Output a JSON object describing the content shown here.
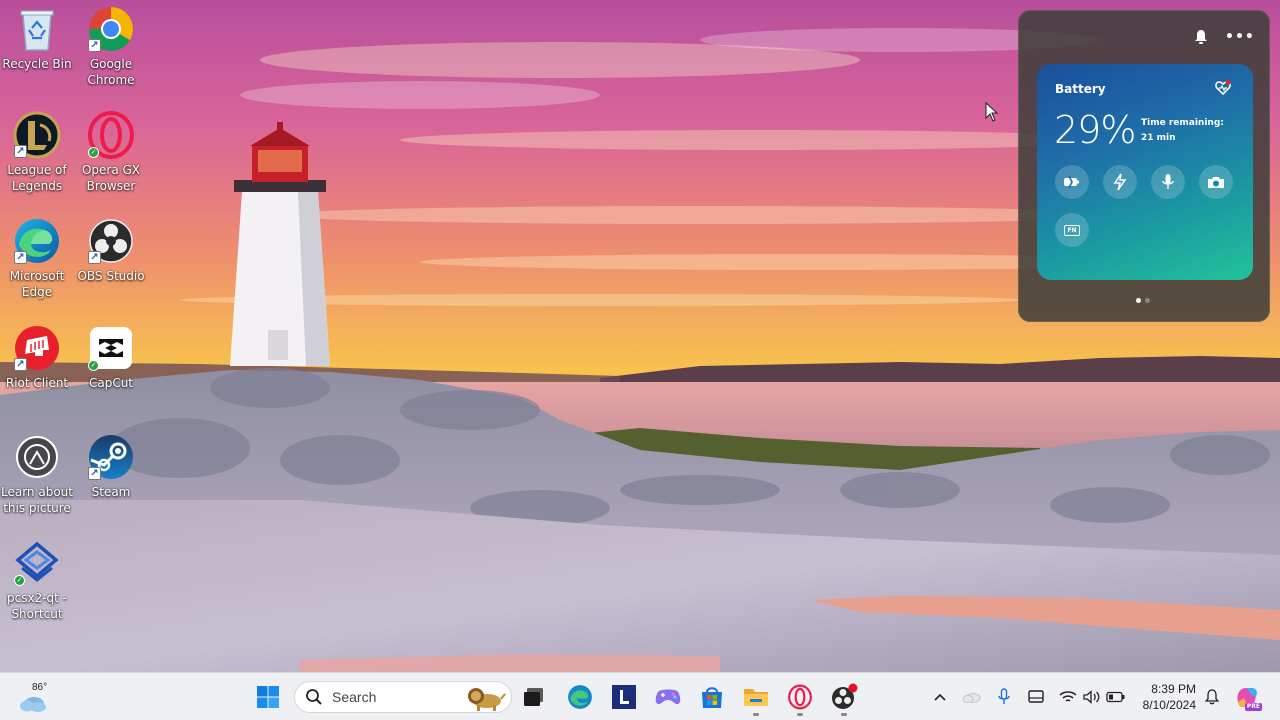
{
  "desktop": {
    "icons": [
      {
        "label": "Recycle Bin",
        "icon": "recycle-bin-icon"
      },
      {
        "label": "Google Chrome",
        "icon": "chrome-icon"
      },
      {
        "label": "League of Legends",
        "icon": "league-of-legends-icon"
      },
      {
        "label": "Opera GX Browser",
        "icon": "opera-gx-icon"
      },
      {
        "label": "Microsoft Edge",
        "icon": "edge-icon"
      },
      {
        "label": "OBS Studio",
        "icon": "obs-studio-icon"
      },
      {
        "label": "Riot Client",
        "icon": "riot-client-icon"
      },
      {
        "label": "CapCut",
        "icon": "capcut-icon"
      },
      {
        "label": "Learn about this picture",
        "icon": "learn-about-picture-icon"
      },
      {
        "label": "Steam",
        "icon": "steam-icon"
      },
      {
        "label": "pcsx2-qt - Shortcut",
        "icon": "pcsx2-icon"
      }
    ]
  },
  "battery_widget": {
    "title": "Battery",
    "percent": "29%",
    "time_label": "Time remaining:",
    "time_value": "21 min",
    "fn_label": "FN",
    "quick_actions": [
      "battery-saver-icon",
      "performance-icon",
      "microphone-icon",
      "camera-icon",
      "fn-key-icon"
    ],
    "pages": 2,
    "active_page": 1
  },
  "taskbar": {
    "weather_temp": "86°",
    "search_placeholder": "Search",
    "apps": [
      "start-icon",
      "task-view-icon",
      "edge-icon",
      "lenovo-l-icon",
      "game-controller-icon",
      "microsoft-store-icon",
      "file-explorer-icon",
      "opera-gx-icon",
      "obs-studio-icon"
    ],
    "tray": [
      "chevron-up-icon",
      "onedrive-cloud-icon",
      "microphone-icon",
      "display-icon",
      "wifi-icon",
      "volume-icon",
      "battery-icon"
    ],
    "clock_time": "8:39 PM",
    "clock_date": "8/10/2024",
    "copilot_badge": "PRE"
  },
  "colors": {
    "taskbar_bg": "#eef0f3",
    "accent": "#0067c0",
    "battery_card_top": "#1b4f9c",
    "battery_card_bottom": "#21c39a"
  }
}
